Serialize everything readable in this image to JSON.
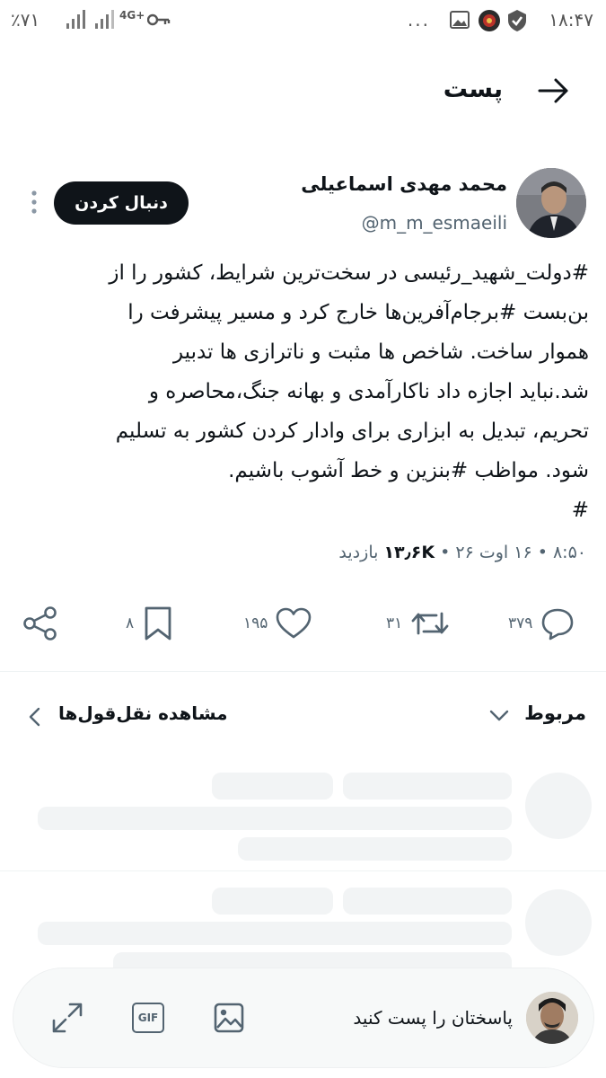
{
  "status_bar": {
    "time": "۱۸:۴۷",
    "battery": "٪۷۱",
    "network": "4G+",
    "more": "..."
  },
  "header": {
    "title": "پست"
  },
  "post": {
    "author_name": "محمد مهدی اسماعیلی",
    "author_handle": "@m_m_esmaeili",
    "follow_label": "دنبال کردن",
    "body_lines": [
      "#دولت_شهید_رئیسی در سخت‌ترین شرایط، کشور را از",
      "بن‌بست #برجام‌آفرین‌ها خارج کرد و مسیر پیشرفت را",
      "هموار ساخت. شاخص ها مثبت و ناترازی ها تدبیر",
      "شد.نباید اجازه داد ناکارآمدی و بهانه جنگ،محاصره و",
      "تحریم، تبدیل به ابزاری برای وادار کردن کشور به تسلیم",
      "شود. مواظب #بنزین و خط آشوب باشیم.",
      "#"
    ],
    "time": "۸:۵۰",
    "date": "۱۶ اوت ۲۶",
    "views_count": "۱۳٫۶K",
    "views_label": "بازدید",
    "separator": "•"
  },
  "actions": {
    "replies": "۳۷۹",
    "reposts": "۳۱",
    "likes": "۱۹۵",
    "bookmarks": "۸"
  },
  "related": {
    "label": "مربوط",
    "quotes_link": "مشاهده نقل‌قول‌ها"
  },
  "reply_bar": {
    "placeholder": "پاسختان را پست کنید",
    "gif_label": "GIF"
  },
  "icons": {
    "back": "arrow-right-icon",
    "more": "vertical-dots-icon",
    "reply": "speech-bubble-icon",
    "repost": "repost-arrows-icon",
    "like": "heart-icon",
    "bookmark": "bookmark-icon",
    "share": "share-nodes-icon"
  },
  "colors": {
    "text": "#0f1419",
    "secondary": "#536471",
    "button_bg": "#0f1419",
    "skeleton": "#f2f4f5"
  }
}
